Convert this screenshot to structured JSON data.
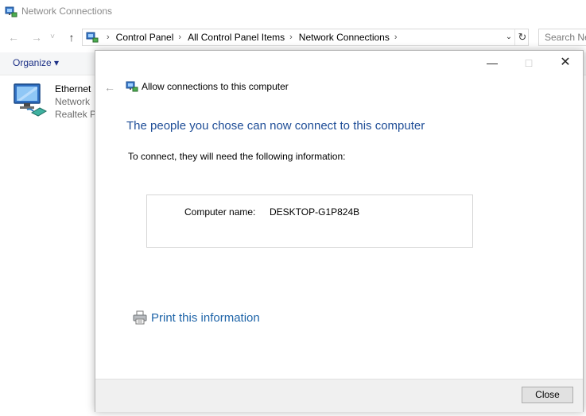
{
  "explorer": {
    "title": "Network Connections",
    "nav": {
      "back": "←",
      "forward": "→",
      "recent": "˅",
      "up": "↑"
    },
    "breadcrumb": [
      "Control Panel",
      "All Control Panel Items",
      "Network Connections"
    ],
    "breadcrumb_sep": "›",
    "search_placeholder": "Search Ne",
    "organize_label": "Organize ▾",
    "items": [
      {
        "name": "Ethernet",
        "status": "Network",
        "device": "Realtek PC"
      }
    ]
  },
  "dialog": {
    "title": "Allow connections to this computer",
    "heading": "The people you chose can now connect to this computer",
    "intro": "To connect, they will need the following information:",
    "computer_name_label": "Computer name:",
    "computer_name_value": "DESKTOP-G1P824B",
    "print_link": "Print this information",
    "close_button": "Close",
    "caption": {
      "minimize": "—",
      "maximize": "□",
      "close": "✕"
    },
    "back": "←"
  },
  "colors": {
    "heading": "#1e4d97",
    "link": "#1e64a8",
    "organize": "#1e3287",
    "footer_bg": "#f0f0f0"
  },
  "icons": [
    "network-connections-icon",
    "network-adapter-icon",
    "printer-icon",
    "refresh-icon"
  ]
}
